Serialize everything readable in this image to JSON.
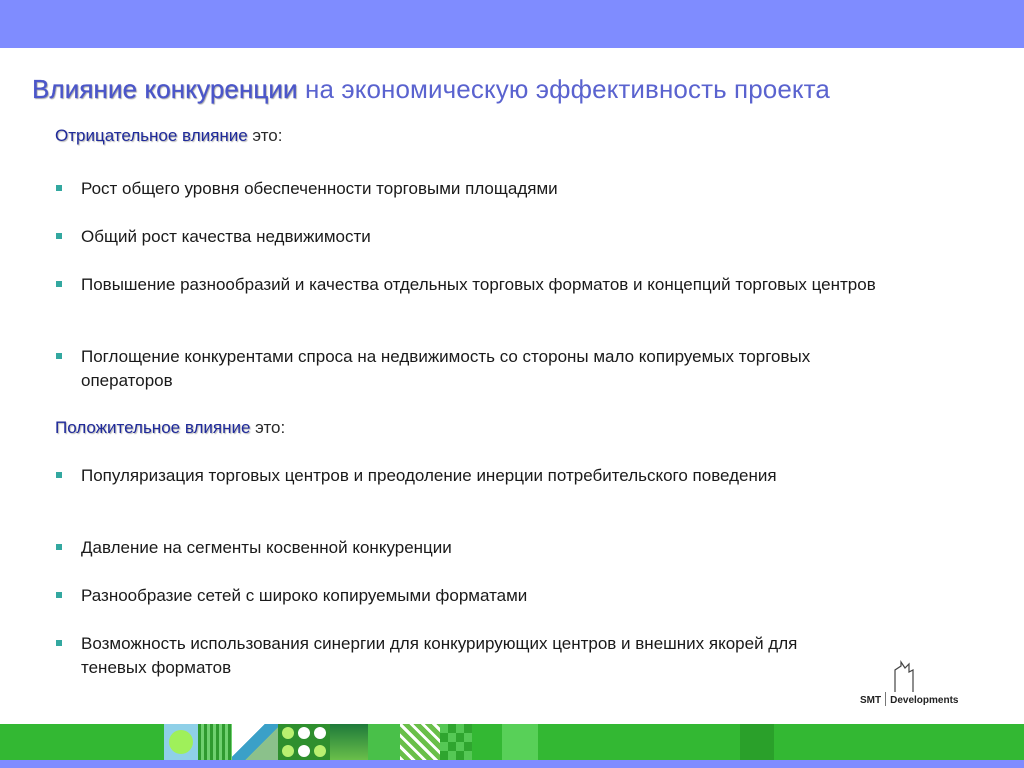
{
  "slide": {
    "title_highlight": "Влияние конкуренции",
    "title_rest": " на экономическую эффективность проекта"
  },
  "negative": {
    "heading_highlight": "Отрицательное влияние",
    "heading_rest": " это:",
    "items": [
      "Рост общего уровня обеспеченности торговыми площадями",
      "Общий рост качества недвижимости",
      "Повышение разнообразий и качества отдельных торговых форматов и концепций торговых центров",
      "Поглощение конкурентами спроса на недвижимость со стороны мало копируемых торговых операторов"
    ]
  },
  "positive": {
    "heading_highlight": "Положительное влияние",
    "heading_rest": " это:",
    "items": [
      "Популяризация торговых центров и преодоление инерции потребительского поведения",
      "Давление на сегменты косвенной конкуренции",
      "Разнообразие сетей с широко копируемыми форматами",
      "Возможность использования синергии для конкурирующих центров и внешних якорей для теневых форматов"
    ]
  },
  "logo": {
    "left": "SMT",
    "right": "Developments",
    "icon": "building-outline-icon"
  },
  "colors": {
    "top_bar": "#7f8cff",
    "title": "#4b56c9",
    "heading": "#1f2a9a",
    "bullet": "#33a8a0",
    "bottom_band": "#33b833"
  }
}
